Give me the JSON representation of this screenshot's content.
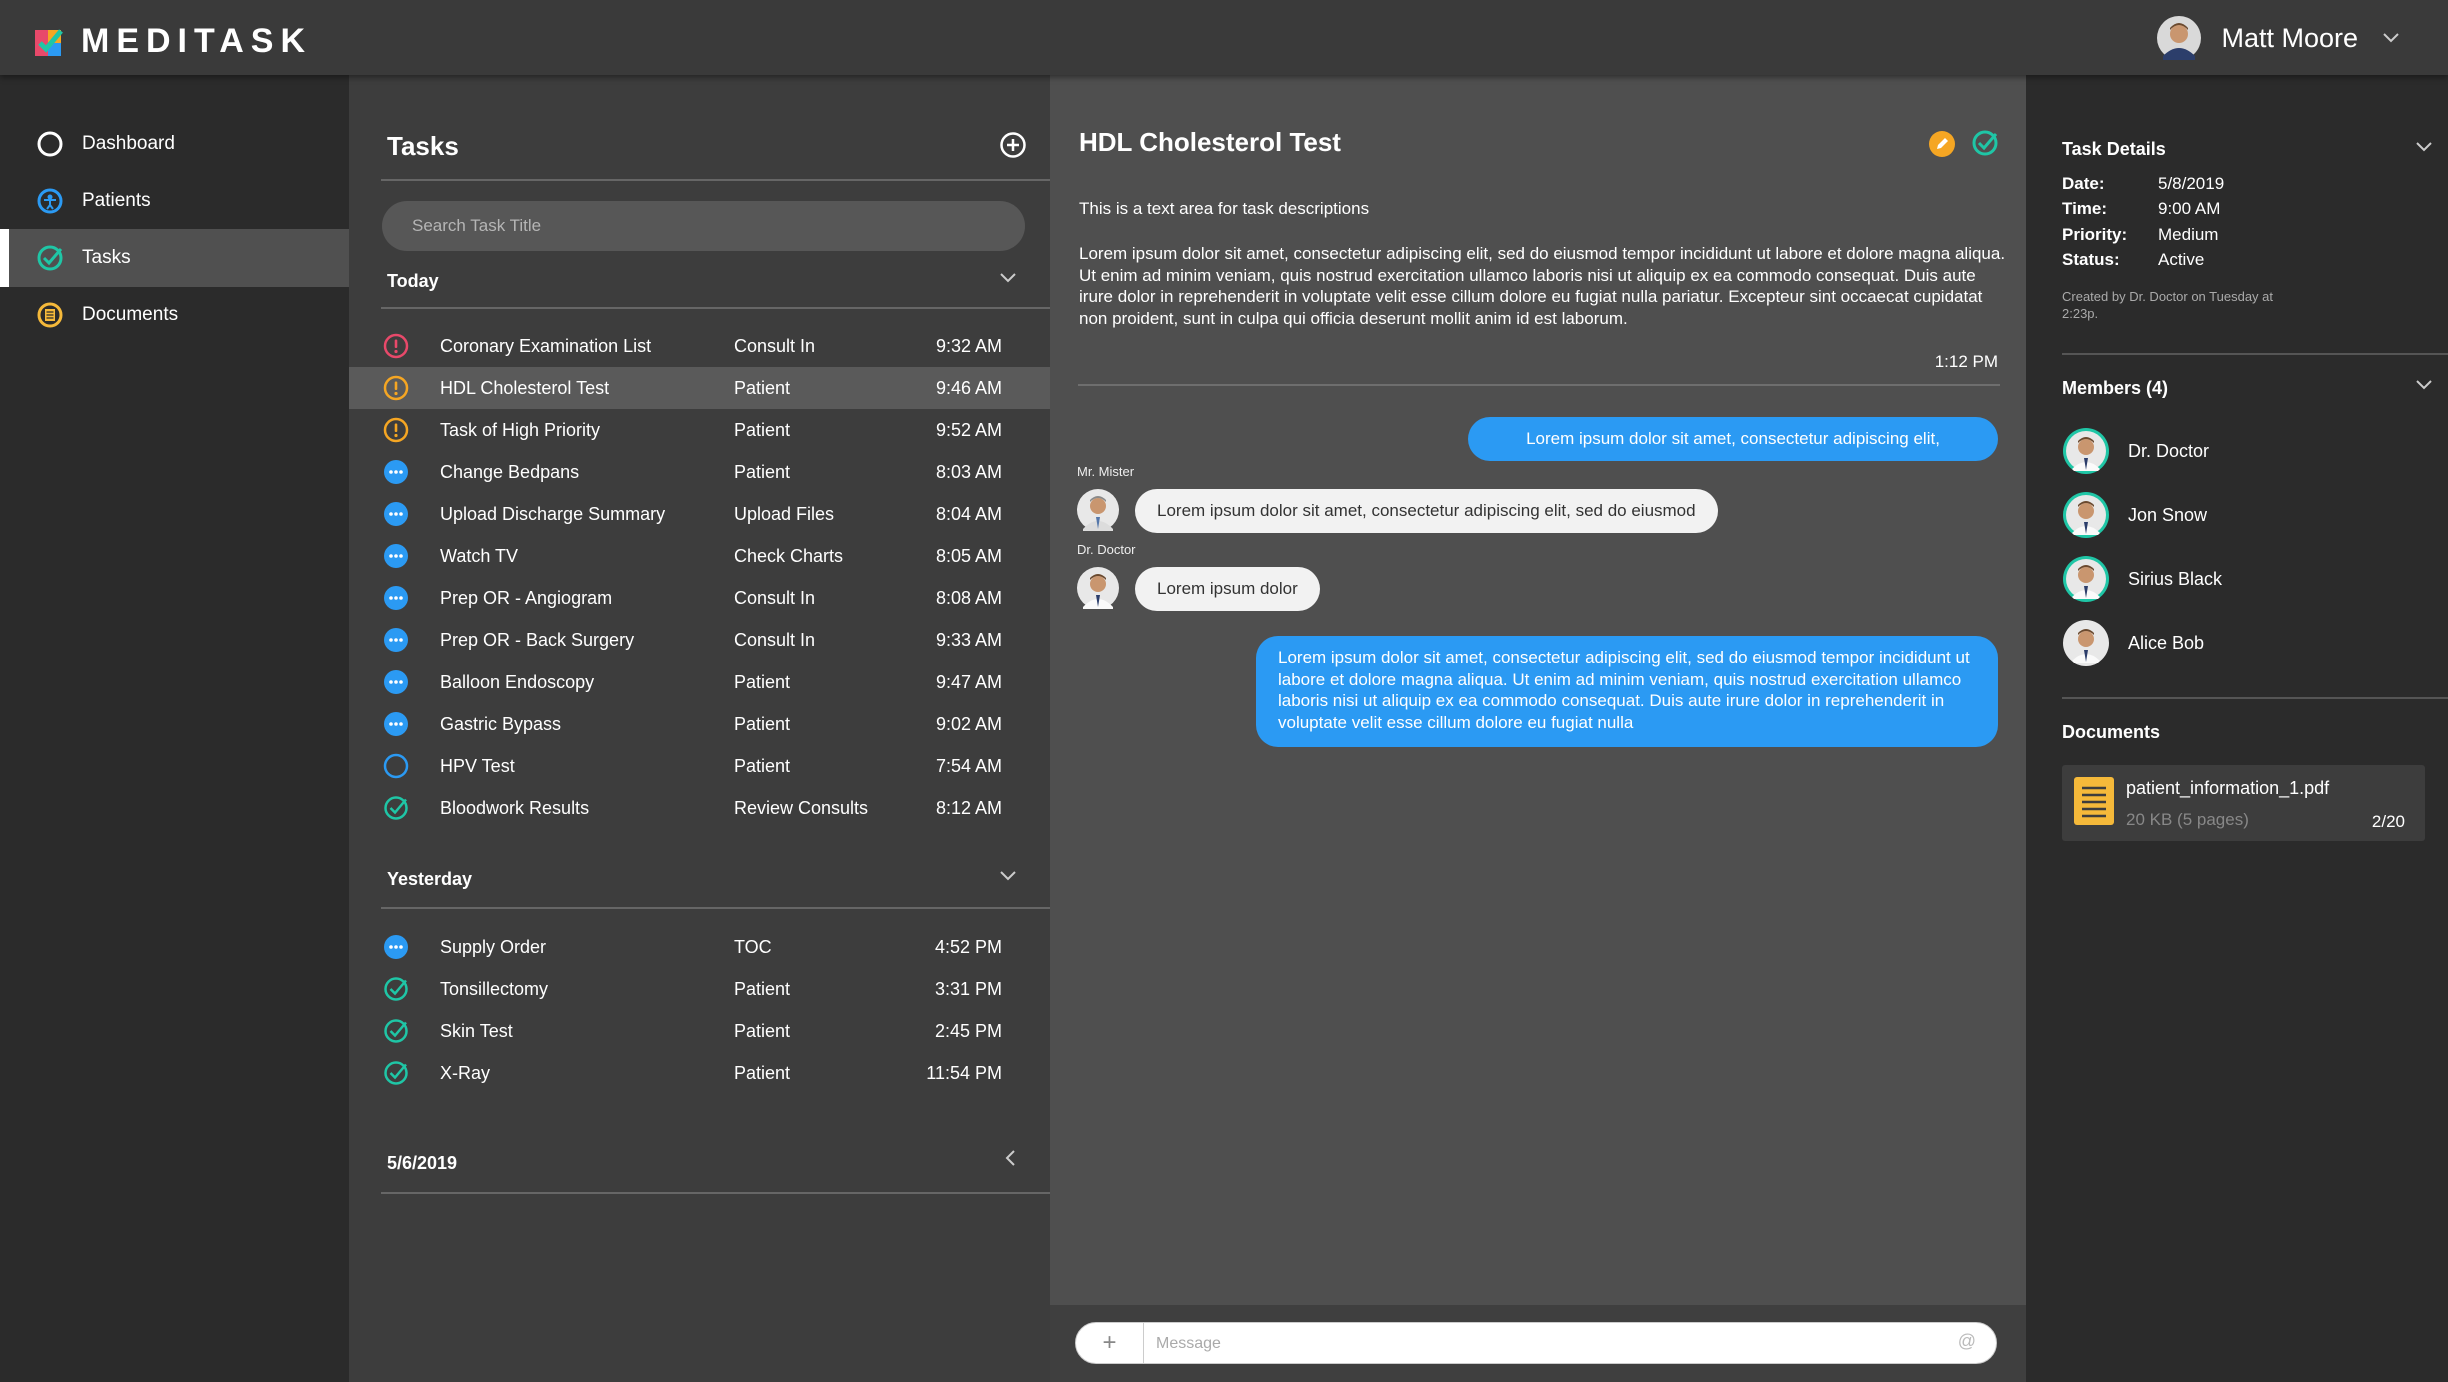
{
  "app": {
    "name": "MEDITASK"
  },
  "user": {
    "name": "Matt Moore"
  },
  "nav": {
    "items": [
      {
        "label": "Dashboard",
        "icon": "circle-icon"
      },
      {
        "label": "Patients",
        "icon": "patient-icon"
      },
      {
        "label": "Tasks",
        "icon": "check-circle-icon",
        "active": true
      },
      {
        "label": "Documents",
        "icon": "document-icon"
      }
    ]
  },
  "tasks": {
    "title": "Tasks",
    "search_placeholder": "Search Task Title",
    "today_label": "Today",
    "yesterday_label": "Yesterday",
    "older_label": "5/6/2019",
    "today": [
      {
        "name": "Coronary Examination List",
        "type": "Consult In",
        "time": "9:32 AM",
        "status": "urgent"
      },
      {
        "name": "HDL Cholesterol Test",
        "type": "Patient",
        "time": "9:46 AM",
        "status": "warning"
      },
      {
        "name": "Task of High Priority",
        "type": "Patient",
        "time": "9:52 AM",
        "status": "warning"
      },
      {
        "name": "Change Bedpans",
        "type": "Patient",
        "time": "8:03 AM",
        "status": "pending"
      },
      {
        "name": "Upload Discharge Summary",
        "type": "Upload Files",
        "time": "8:04 AM",
        "status": "pending"
      },
      {
        "name": "Watch TV",
        "type": "Check Charts",
        "time": "8:05 AM",
        "status": "pending"
      },
      {
        "name": "Prep OR - Angiogram",
        "type": "Consult In",
        "time": "8:08 AM",
        "status": "pending"
      },
      {
        "name": "Prep OR - Back Surgery",
        "type": "Consult In",
        "time": "9:33 AM",
        "status": "pending"
      },
      {
        "name": "Balloon Endoscopy",
        "type": "Patient",
        "time": "9:47 AM",
        "status": "pending"
      },
      {
        "name": "Gastric Bypass",
        "type": "Patient",
        "time": "9:02 AM",
        "status": "pending"
      },
      {
        "name": "HPV Test",
        "type": "Patient",
        "time": "7:54 AM",
        "status": "open"
      },
      {
        "name": "Bloodwork Results",
        "type": "Review Consults",
        "time": "8:12 AM",
        "status": "done"
      }
    ],
    "yesterday": [
      {
        "name": "Supply Order",
        "type": "TOC",
        "time": "4:52 PM",
        "status": "pending"
      },
      {
        "name": "Tonsillectomy",
        "type": "Patient",
        "time": "3:31 PM",
        "status": "done"
      },
      {
        "name": "Skin Test",
        "type": "Patient",
        "time": "2:45 PM",
        "status": "done"
      },
      {
        "name": "X-Ray",
        "type": "Patient",
        "time": "11:54 PM",
        "status": "done"
      }
    ]
  },
  "detail": {
    "title": "HDL Cholesterol Test",
    "subtitle": "This is a text area for task descriptions",
    "description": "Lorem ipsum dolor sit amet, consectetur adipiscing elit, sed do eiusmod tempor incididunt ut labore et dolore magna aliqua. Ut enim ad minim veniam, quis nostrud exercitation ullamco laboris nisi ut aliquip ex ea commodo consequat. Duis aute irure dolor in reprehenderit in voluptate velit esse cillum dolore eu fugiat nulla pariatur. Excepteur sint occaecat cupidatat non proident, sunt in culpa qui officia deserunt mollit anim id est laborum.",
    "time": "1:12 PM",
    "messages": {
      "m1": "Lorem ipsum dolor sit amet, consectetur adipiscing elit,",
      "m2_sender": "Mr. Mister",
      "m2": "Lorem ipsum dolor sit amet, consectetur adipiscing elit, sed do eiusmod",
      "m3_sender": "Dr. Doctor",
      "m3": "Lorem ipsum dolor",
      "m4": "Lorem ipsum dolor sit amet, consectetur adipiscing elit, sed do eiusmod tempor incididunt ut labore et dolore magna aliqua. Ut enim ad minim veniam, quis nostrud exercitation ullamco laboris nisi ut aliquip ex ea commodo consequat. Duis aute irure dolor in reprehenderit in voluptate velit esse cillum dolore eu fugiat nulla"
    },
    "composer": {
      "plus": "+",
      "placeholder": "Message",
      "at": "@"
    }
  },
  "right": {
    "task_details_label": "Task Details",
    "details": [
      {
        "key": "Date:",
        "value": "5/8/2019"
      },
      {
        "key": "Time:",
        "value": "9:00 AM"
      },
      {
        "key": "Priority:",
        "value": "Medium"
      },
      {
        "key": "Status:",
        "value": "Active"
      }
    ],
    "created_note": "Created by Dr. Doctor on Tuesday at 2:23p.",
    "members_label": "Members (4)",
    "members": [
      "Dr. Doctor",
      "Jon Snow",
      "Sirius Black",
      "Alice Bob"
    ],
    "documents_label": "Documents",
    "document": {
      "name": "patient_information_1.pdf",
      "meta": "20 KB (5 pages)",
      "page": "2/20"
    }
  },
  "colors": {
    "accent_blue": "#2b9af3",
    "urgent_red": "#e8496a",
    "warning_orange": "#f5a623",
    "done_green": "#1fc6a6",
    "doc_yellow": "#f5b93a"
  }
}
